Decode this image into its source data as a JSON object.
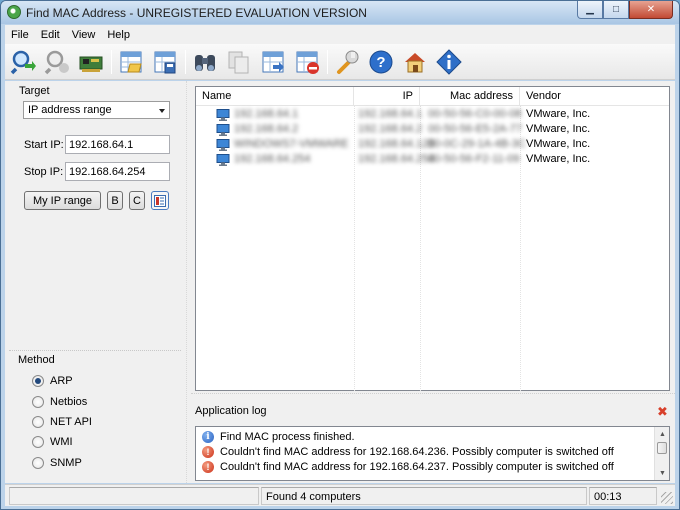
{
  "window": {
    "title": "Find MAC Address - UNREGISTERED EVALUATION VERSION"
  },
  "menu": [
    "File",
    "Edit",
    "View",
    "Help"
  ],
  "toolbar": [
    {
      "icon": "magnifier-go-icon"
    },
    {
      "icon": "magnifier-stop-icon"
    },
    {
      "icon": "network-card-icon"
    },
    {
      "icon": "open-table-icon"
    },
    {
      "icon": "save-table-icon"
    },
    {
      "icon": "binoculars-icon"
    },
    {
      "icon": "copy-icon"
    },
    {
      "icon": "export-table-icon"
    },
    {
      "icon": "delete-table-icon"
    },
    {
      "icon": "wrench-icon"
    },
    {
      "icon": "help-icon"
    },
    {
      "icon": "home-icon"
    },
    {
      "icon": "info-diamond-icon"
    }
  ],
  "target": {
    "label": "Target",
    "mode": "IP address range",
    "start_label": "Start IP:",
    "start_value": "192.168.64.1",
    "stop_label": "Stop IP:",
    "stop_value": "192.168.64.254",
    "my_range_button": "My IP range",
    "b_button": "B",
    "c_button": "C"
  },
  "method": {
    "label": "Method",
    "options": [
      "ARP",
      "Netbios",
      "NET API",
      "WMI",
      "SNMP"
    ],
    "selected": "ARP"
  },
  "results": {
    "columns": [
      "Name",
      "IP",
      "Mac address",
      "Vendor"
    ],
    "rows": [
      {
        "name": "192.168.64.1",
        "ip": "192.168.64.1",
        "mac": "00-50-56-C0-00-08",
        "vendor": "VMware, Inc."
      },
      {
        "name": "192.168.64.2",
        "ip": "192.168.64.2",
        "mac": "00-50-56-E5-2A-77",
        "vendor": "VMware, Inc."
      },
      {
        "name": "WINDOWS7-VMWARE",
        "ip": "192.168.64.128",
        "mac": "00-0C-29-1A-4B-3C",
        "vendor": "VMware, Inc."
      },
      {
        "name": "192.168.64.254",
        "ip": "192.168.64.254",
        "mac": "00-50-56-F2-11-09",
        "vendor": "VMware, Inc."
      }
    ]
  },
  "log": {
    "title": "Application log",
    "entries": [
      {
        "type": "info",
        "text": "Find MAC process finished."
      },
      {
        "type": "error",
        "text": "Couldn't find MAC address for 192.168.64.236. Possibly computer is switched off"
      },
      {
        "type": "error",
        "text": "Couldn't find MAC address for 192.168.64.237. Possibly computer is switched off"
      }
    ]
  },
  "status": {
    "message": "Found 4 computers",
    "elapsed": "00:13"
  }
}
